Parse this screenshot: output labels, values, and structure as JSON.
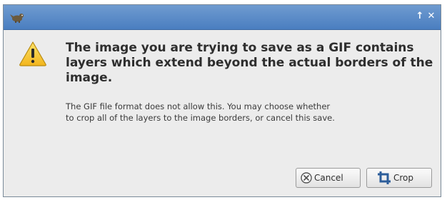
{
  "window": {
    "titlebar_color": "#4a7ec0",
    "icons": {
      "app": "gimp-icon",
      "keep_above": "up-arrow-icon",
      "close": "close-icon"
    },
    "keep_above_glyph": "↑",
    "close_glyph": "✕"
  },
  "dialog": {
    "warning_icon": "warning-icon",
    "headline": "The image you are trying to save as a GIF contains layers which extend beyond the actual borders of the image.",
    "body": "The GIF file format does not allow this.  You may choose whether to crop all of the layers to the image borders, or cancel this save."
  },
  "buttons": {
    "cancel": {
      "label": "Cancel",
      "icon": "cancel-circle-icon"
    },
    "crop": {
      "label": "Crop",
      "icon": "crop-icon"
    }
  }
}
